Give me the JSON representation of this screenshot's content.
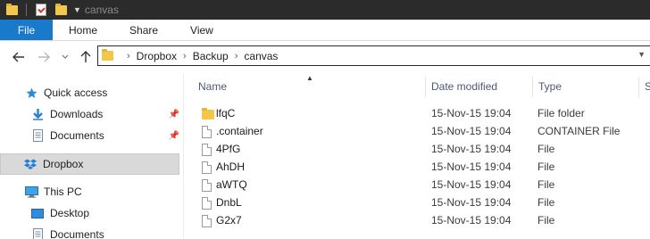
{
  "window": {
    "title": "canvas",
    "quick_access_toolbar": [
      "folder-icon",
      "properties-icon",
      "new-folder-icon",
      "customize-dropdown-icon"
    ]
  },
  "ribbon": {
    "tabs": [
      "File",
      "Home",
      "Share",
      "View"
    ],
    "active_tab": "File",
    "accent": "#1979ca"
  },
  "navigation": {
    "back": "arrow-left-icon",
    "forward": "arrow-right-icon",
    "recent": "chevron-down-icon",
    "up": "arrow-up-icon"
  },
  "address_bar": {
    "breadcrumbs": [
      "Dropbox",
      "Backup",
      "canvas"
    ]
  },
  "sidebar": {
    "items": [
      {
        "label": "Quick access",
        "icon": "star-icon",
        "pinned": false
      },
      {
        "label": "Downloads",
        "icon": "download-icon",
        "pinned": true
      },
      {
        "label": "Documents",
        "icon": "document-icon",
        "pinned": true
      },
      {
        "label": "Dropbox",
        "icon": "dropbox-icon",
        "pinned": false,
        "selected": true
      },
      {
        "label": "This PC",
        "icon": "computer-icon",
        "pinned": false
      },
      {
        "label": "Desktop",
        "icon": "desktop-icon",
        "pinned": false
      },
      {
        "label": "Documents",
        "icon": "document-icon",
        "pinned": false
      }
    ]
  },
  "file_list": {
    "columns": [
      "Name",
      "Date modified",
      "Type",
      "S"
    ],
    "sort_column": "Name",
    "rows": [
      {
        "name": "lfqC",
        "date": "15-Nov-15 19:04",
        "type": "File folder",
        "icon": "folder-icon"
      },
      {
        "name": ".container",
        "date": "15-Nov-15 19:04",
        "type": "CONTAINER File",
        "icon": "file-icon"
      },
      {
        "name": "4PfG",
        "date": "15-Nov-15 19:04",
        "type": "File",
        "icon": "file-icon"
      },
      {
        "name": "AhDH",
        "date": "15-Nov-15 19:04",
        "type": "File",
        "icon": "file-icon"
      },
      {
        "name": "aWTQ",
        "date": "15-Nov-15 19:04",
        "type": "File",
        "icon": "file-icon"
      },
      {
        "name": "DnbL",
        "date": "15-Nov-15 19:04",
        "type": "File",
        "icon": "file-icon"
      },
      {
        "name": "G2x7",
        "date": "15-Nov-15 19:04",
        "type": "File",
        "icon": "file-icon"
      }
    ]
  }
}
